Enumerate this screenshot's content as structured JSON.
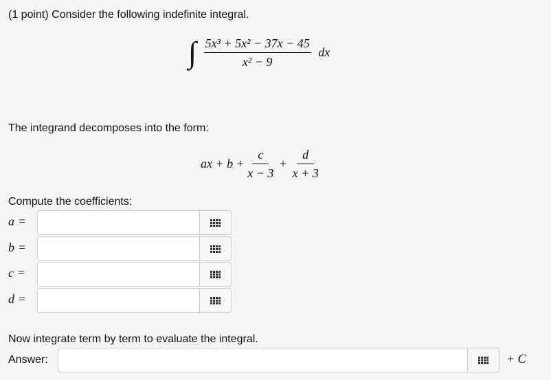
{
  "problem": {
    "intro": "(1 point) Consider the following indefinite integral.",
    "integral": {
      "integral_sign": "∫",
      "numerator": "5x³ + 5x² − 37x − 45",
      "denominator": "x² − 9",
      "differential": "dx"
    },
    "decomposition_text": "The integrand decomposes into the form:",
    "form": {
      "lead": "ax + b +",
      "frac1_num": "c",
      "frac1_den": "x − 3",
      "plus": "+",
      "frac2_num": "d",
      "frac2_den": "x + 3"
    },
    "compute_text": "Compute the coefficients:",
    "coefficients": [
      {
        "label": "a",
        "eq": "=",
        "value": ""
      },
      {
        "label": "b",
        "eq": "=",
        "value": ""
      },
      {
        "label": "c",
        "eq": "=",
        "value": ""
      },
      {
        "label": "d",
        "eq": "=",
        "value": ""
      }
    ],
    "integrate_text": "Now integrate term by term to evaluate the integral.",
    "answer_label": "Answer:",
    "answer_value": "",
    "constant": "+ C"
  },
  "icons": {
    "equation_editor": "keypad-grid-icon"
  }
}
